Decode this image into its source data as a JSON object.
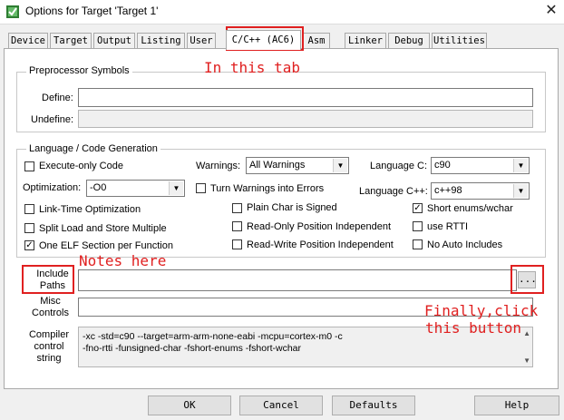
{
  "window": {
    "title": "Options for Target 'Target 1'",
    "close_glyph": "✕"
  },
  "tabs": [
    {
      "label": "Device"
    },
    {
      "label": "Target"
    },
    {
      "label": "Output"
    },
    {
      "label": "Listing"
    },
    {
      "label": "User"
    },
    {
      "label": "C/C++ (AC6)"
    },
    {
      "label": "Asm"
    },
    {
      "label": "Linker"
    },
    {
      "label": "Debug"
    },
    {
      "label": "Utilities"
    }
  ],
  "preprocessor": {
    "title": "Preprocessor Symbols",
    "define_label": "Define:",
    "define_value": "",
    "undefine_label": "Undefine:",
    "undefine_value": ""
  },
  "language": {
    "title": "Language / Code Generation",
    "execute_only": {
      "label": "Execute-only Code",
      "checked": false,
      "mark": ""
    },
    "warnings_label": "Warnings:",
    "warnings_value": "All Warnings",
    "language_c_label": "Language C:",
    "language_c_value": "c90",
    "optimization_label": "Optimization:",
    "optimization_value": "-O0",
    "turn_warnings": {
      "label": "Turn Warnings into Errors",
      "checked": false,
      "mark": ""
    },
    "language_cpp_label": "Language C++:",
    "language_cpp_value": "c++98",
    "link_time": {
      "label": "Link-Time Optimization",
      "checked": false,
      "mark": ""
    },
    "plain_char": {
      "label": "Plain Char is Signed",
      "checked": false,
      "mark": ""
    },
    "short_enums": {
      "label": "Short enums/wchar",
      "checked": true,
      "mark": "✓"
    },
    "split_load": {
      "label": "Split Load and Store Multiple",
      "checked": false,
      "mark": ""
    },
    "ropi": {
      "label": "Read-Only Position Independent",
      "checked": false,
      "mark": ""
    },
    "use_rtti": {
      "label": "use RTTI",
      "checked": false,
      "mark": ""
    },
    "one_elf": {
      "label": "One ELF Section per Function",
      "checked": true,
      "mark": "✓"
    },
    "rwpi": {
      "label": "Read-Write Position Independent",
      "checked": false,
      "mark": ""
    },
    "no_auto_includes": {
      "label": "No Auto Includes",
      "checked": false,
      "mark": ""
    }
  },
  "include_paths": {
    "label_line1": "Include",
    "label_line2": "Paths",
    "value": "",
    "browse_label": "..."
  },
  "misc_controls": {
    "label_line1": "Misc",
    "label_line2": "Controls",
    "value": ""
  },
  "compiler_string": {
    "label_line1": "Compiler",
    "label_line2": "control",
    "label_line3": "string",
    "line1": "-xc -std=c90 --target=arm-arm-none-eabi -mcpu=cortex-m0 -c",
    "line2": "-fno-rtti -funsigned-char -fshort-enums -fshort-wchar"
  },
  "buttons": {
    "ok": "OK",
    "cancel": "Cancel",
    "defaults": "Defaults",
    "help": "Help"
  },
  "annotations": {
    "tab_note": "In this tab",
    "notes_note": "Notes here",
    "button_note_line1": "Finally,click",
    "button_note_line2": "this button",
    "color": "#e02020"
  }
}
